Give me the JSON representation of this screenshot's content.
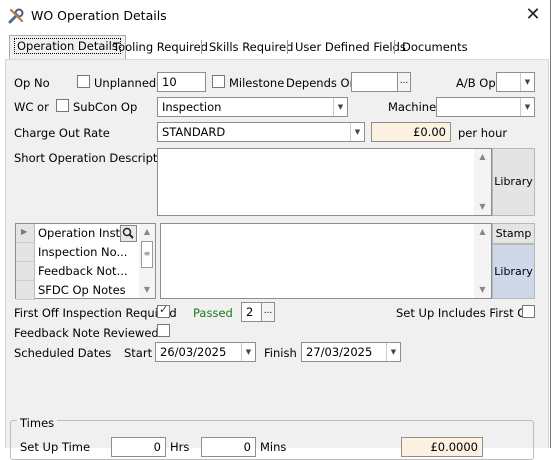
{
  "window": {
    "title": "WO Operation Details",
    "close_glyph": "✕"
  },
  "tabs": [
    {
      "label": "Operation Details",
      "active": true
    },
    {
      "label": "Tooling Required"
    },
    {
      "label": "Skills Required"
    },
    {
      "label": "User Defined Fields"
    },
    {
      "label": "Documents"
    }
  ],
  "form": {
    "op_no_label": "Op No",
    "unplanned_label": "Unplanned",
    "unplanned_checked": false,
    "op_no_value": "10",
    "milestone_label": "Milestone",
    "milestone_checked": false,
    "depends_on_label": "Depends On",
    "depends_on_value": "",
    "ab_op_label": "A/B Op",
    "ab_op_value": "",
    "wc_or_label": "WC or",
    "subcon_label": "SubCon Op",
    "subcon_checked": false,
    "wc_value": "Inspection",
    "machine_label": "Machine",
    "machine_value": "",
    "charge_label": "Charge Out Rate",
    "charge_value": "STANDARD",
    "rate_value": "£0.00",
    "per_hour_label": "per hour",
    "short_desc_label": "Short Operation Description",
    "short_desc_value": "",
    "library_label": "Library",
    "notes_rows": [
      "Operation Inst...",
      "Inspection No...",
      "Feedback Not...",
      "SFDC Op Notes"
    ],
    "stamp_label": "Stamp",
    "library2_label": "Library",
    "first_off_label": "First Off Inspection Required",
    "first_off_checked": true,
    "passed_label": "Passed",
    "passed_value": "2",
    "setup_first_off_label": "Set Up Includes First Off",
    "setup_first_off_checked": false,
    "feedback_label": "Feedback Note Reviewed",
    "feedback_checked": false,
    "sched_label": "Scheduled Dates",
    "start_label": "Start",
    "start_value": "26/03/2025",
    "finish_label": "Finish",
    "finish_value": "27/03/2025"
  },
  "times": {
    "legend": "Times",
    "setup_label": "Set Up Time",
    "hrs_value": "0",
    "hrs_label": "Hrs",
    "mins_value": "0",
    "mins_label": "Mins",
    "cost_value": "£0.0000"
  },
  "icons": {
    "app": "wrench-screwdriver-icon",
    "ellipsis": "...",
    "search": "magnifier-icon"
  }
}
